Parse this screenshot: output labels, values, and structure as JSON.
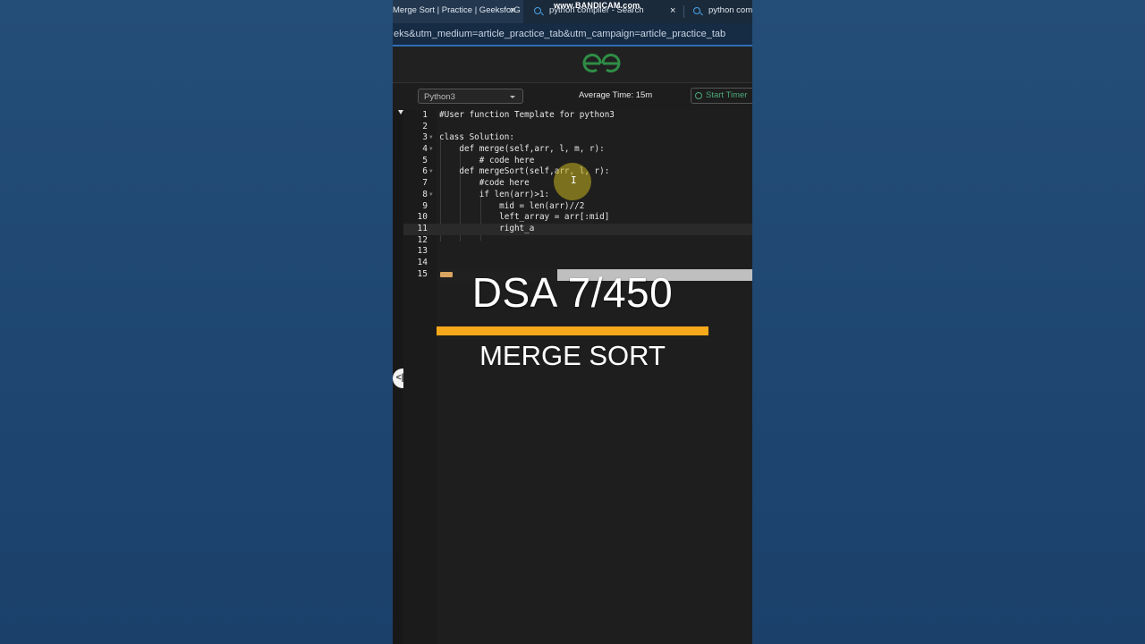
{
  "browser": {
    "tabs": [
      {
        "label": "Merge Sort | Practice | GeeksforG",
        "close": "×",
        "active": true
      },
      {
        "label": "python compiler - Search",
        "close": "×",
        "active": false,
        "icon": "search-icon"
      },
      {
        "label": "python comp",
        "active": false,
        "icon": "search-icon"
      }
    ],
    "watermark": "www.BANDICAM.com",
    "url": "eks&utm_medium=article_practice_tab&utm_campaign=article_practice_tab"
  },
  "header": {
    "logo_icon": "gfg-logo-icon",
    "logo_color": "#2f8d46"
  },
  "toolbar": {
    "language": "Python3",
    "average_time": "Average Time: 15m",
    "start_timer": "Start Timer"
  },
  "editor": {
    "lines": [
      {
        "n": "1",
        "text": "#User function Template for python3"
      },
      {
        "n": "2",
        "text": ""
      },
      {
        "n": "3",
        "text": "class Solution:"
      },
      {
        "n": "4",
        "text": "    def merge(self,arr, l, m, r):"
      },
      {
        "n": "5",
        "text": "        # code here"
      },
      {
        "n": "6",
        "text": "    def mergeSort(self,arr, l, r):"
      },
      {
        "n": "7",
        "text": "        #code here"
      },
      {
        "n": "8",
        "text": "        if len(arr)>1:"
      },
      {
        "n": "9",
        "text": "            mid = len(arr)//2"
      },
      {
        "n": "10",
        "text": "            left_array = arr[:mid]"
      },
      {
        "n": "11",
        "text": "            right_a"
      },
      {
        "n": "12",
        "text": ""
      },
      {
        "n": "13",
        "text": ""
      },
      {
        "n": "14",
        "text": ""
      },
      {
        "n": "15",
        "text": ""
      }
    ]
  },
  "overlay": {
    "title": "DSA 7/450",
    "topic": "MERGE SORT",
    "accent": "#f5a81a"
  }
}
